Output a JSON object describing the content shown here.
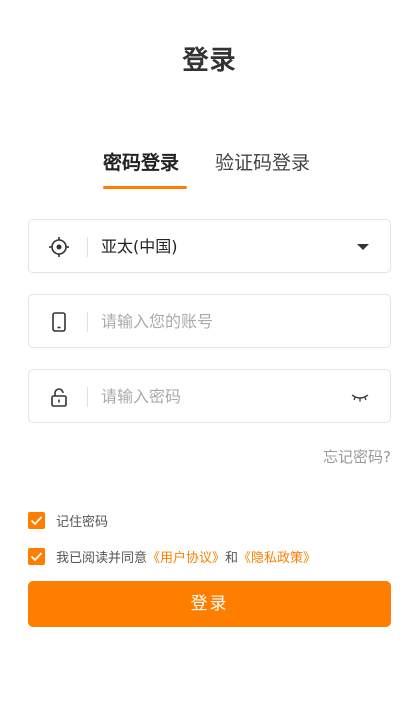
{
  "page": {
    "title": "登录"
  },
  "tabs": [
    {
      "label": "密码登录",
      "active": true
    },
    {
      "label": "验证码登录",
      "active": false
    }
  ],
  "region": {
    "value": "亚太(中国)",
    "icon": "locate-icon"
  },
  "account": {
    "placeholder": "请输入您的账号",
    "value": "",
    "icon": "phone-icon"
  },
  "password": {
    "placeholder": "请输入密码",
    "value": "",
    "icon": "lock-icon",
    "toggle_icon": "eye-closed-icon"
  },
  "forgot": {
    "label": "忘记密码?"
  },
  "remember": {
    "label": "记住密码",
    "checked": true
  },
  "agreement": {
    "checked": true,
    "prefix": "我已阅读并同意",
    "user_link": "《用户协议》",
    "conjunction": "和",
    "privacy_link": "《隐私政策》"
  },
  "submit": {
    "label": "登录"
  },
  "colors": {
    "accent": "#ff7e00",
    "border": "#e3e3e3",
    "placeholder": "#aaaaaa"
  }
}
